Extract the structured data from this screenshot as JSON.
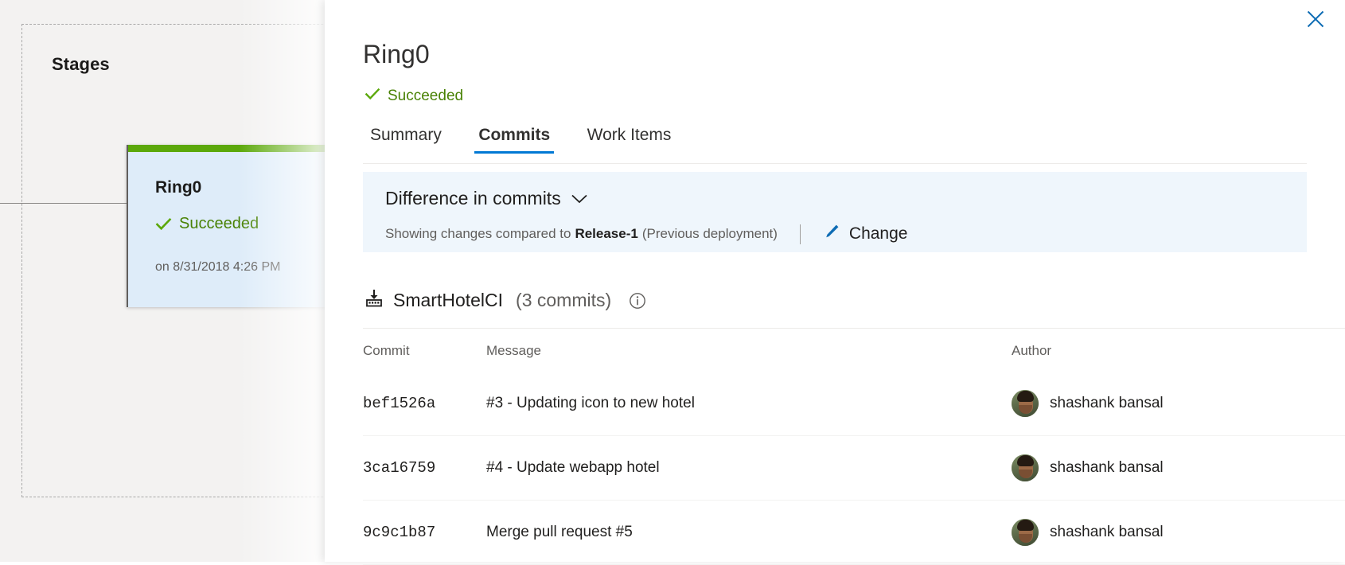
{
  "stages": {
    "title": "Stages",
    "card": {
      "name": "Ring0",
      "status": "Succeeded",
      "timestamp": "on 8/31/2018 4:26 PM",
      "status_color": "#498205",
      "bar_color": "#5ba80a",
      "card_color": "#deecf9"
    }
  },
  "panel": {
    "close_label": "close-icon",
    "title": "Ring0",
    "status": "Succeeded",
    "status_color": "#498205",
    "tabs": [
      {
        "label": "Summary",
        "active": false
      },
      {
        "label": "Commits",
        "active": true
      },
      {
        "label": "Work Items",
        "active": false
      }
    ],
    "accent_color": "#0078d4",
    "diff": {
      "heading": "Difference in commits",
      "chevron": "chevron-down-icon",
      "sub_prefix": "Showing changes compared to",
      "sub_bold": "Release-1",
      "sub_suffix": "(Previous deployment)",
      "change_label": "Change",
      "banner_color": "#eff6fc"
    },
    "repo": {
      "icon": "repository-icon",
      "name": "SmartHotelCI",
      "count": "(3 commits)",
      "info_icon": "info-icon"
    },
    "table": {
      "columns": [
        "Commit",
        "Message",
        "Author"
      ],
      "rows": [
        {
          "commit": "bef1526a",
          "message": "#3 - Updating icon to new hotel",
          "author": "shashank bansal"
        },
        {
          "commit": "3ca16759",
          "message": "#4 - Update webapp hotel",
          "author": "shashank bansal"
        },
        {
          "commit": "9c9c1b87",
          "message": "Merge pull request #5",
          "author": "shashank bansal"
        }
      ]
    }
  }
}
